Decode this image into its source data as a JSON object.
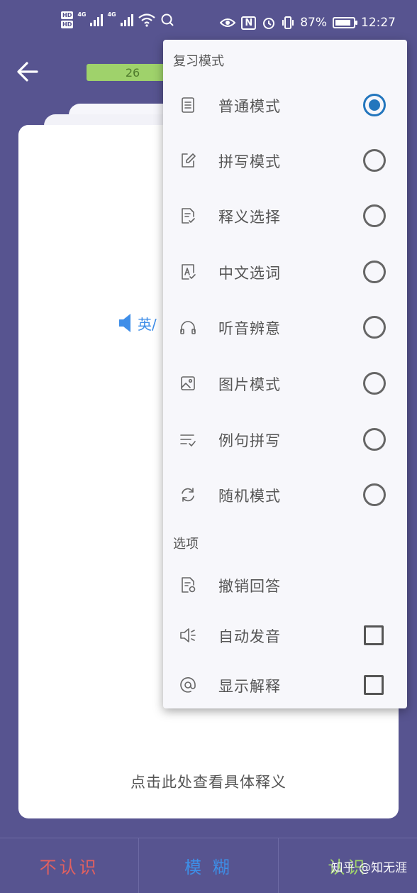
{
  "status_bar": {
    "hd_top": "HD",
    "hd_bottom": "HD",
    "net1": "4G",
    "net2": "4G",
    "nfc": "N",
    "battery": "87%",
    "time": "12:27"
  },
  "header": {
    "progress_value": "26"
  },
  "card": {
    "pron_label": "英/",
    "hint": "点击此处查看具体释义"
  },
  "bottom": {
    "unknown": "不认识",
    "fuzzy": "模 糊",
    "known": "认识"
  },
  "watermark": "知乎 @知无涯",
  "menu": {
    "section_review": "复习模式",
    "modes": [
      {
        "label": "普通模式",
        "icon": "document-icon",
        "selected": true
      },
      {
        "label": "拼写模式",
        "icon": "edit-icon",
        "selected": false
      },
      {
        "label": "释义选择",
        "icon": "doc-check-icon",
        "selected": false
      },
      {
        "label": "中文选词",
        "icon": "letter-check-icon",
        "selected": false
      },
      {
        "label": "听音辨意",
        "icon": "headphones-icon",
        "selected": false
      },
      {
        "label": "图片模式",
        "icon": "image-icon",
        "selected": false
      },
      {
        "label": "例句拼写",
        "icon": "list-check-icon",
        "selected": false
      },
      {
        "label": "随机模式",
        "icon": "refresh-icon",
        "selected": false
      }
    ],
    "section_options": "选项",
    "options": [
      {
        "label": "撤销回答",
        "icon": "doc-undo-icon"
      },
      {
        "label": "自动发音",
        "icon": "speaker-icon",
        "checked": false
      },
      {
        "label": "显示解释",
        "icon": "at-icon",
        "checked": false
      }
    ]
  },
  "colors": {
    "background": "#575490",
    "accent": "#2376bd",
    "progress": "#9fd26b",
    "unknown": "#e06060",
    "fuzzy": "#3d8fe8",
    "known": "#9fd26b"
  }
}
